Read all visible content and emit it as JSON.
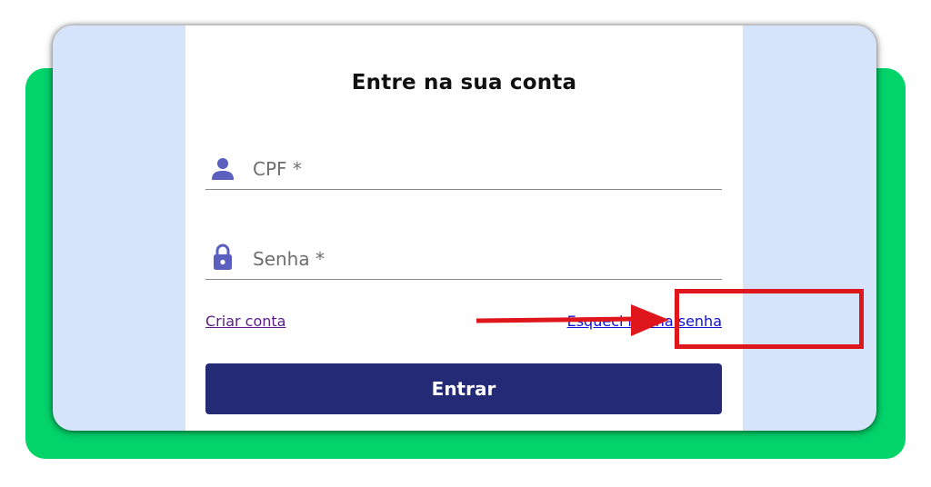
{
  "login": {
    "title": "Entre na sua conta",
    "cpf_label": "CPF *",
    "password_label": "Senha *",
    "create_account_link": "Criar conta",
    "forgot_password_link": "Esqueci minha senha",
    "submit_label": "Entrar"
  },
  "icons": {
    "cpf_field": "person-icon",
    "password_field": "lock-icon"
  },
  "colors": {
    "outer_frame": "#03d46a",
    "background": "#d6e4fb",
    "button": "#242a75",
    "icon": "#5b5fc0",
    "highlight": "#e0161d",
    "link_forgot": "#1010d8",
    "link_create": "#5a1d86"
  }
}
